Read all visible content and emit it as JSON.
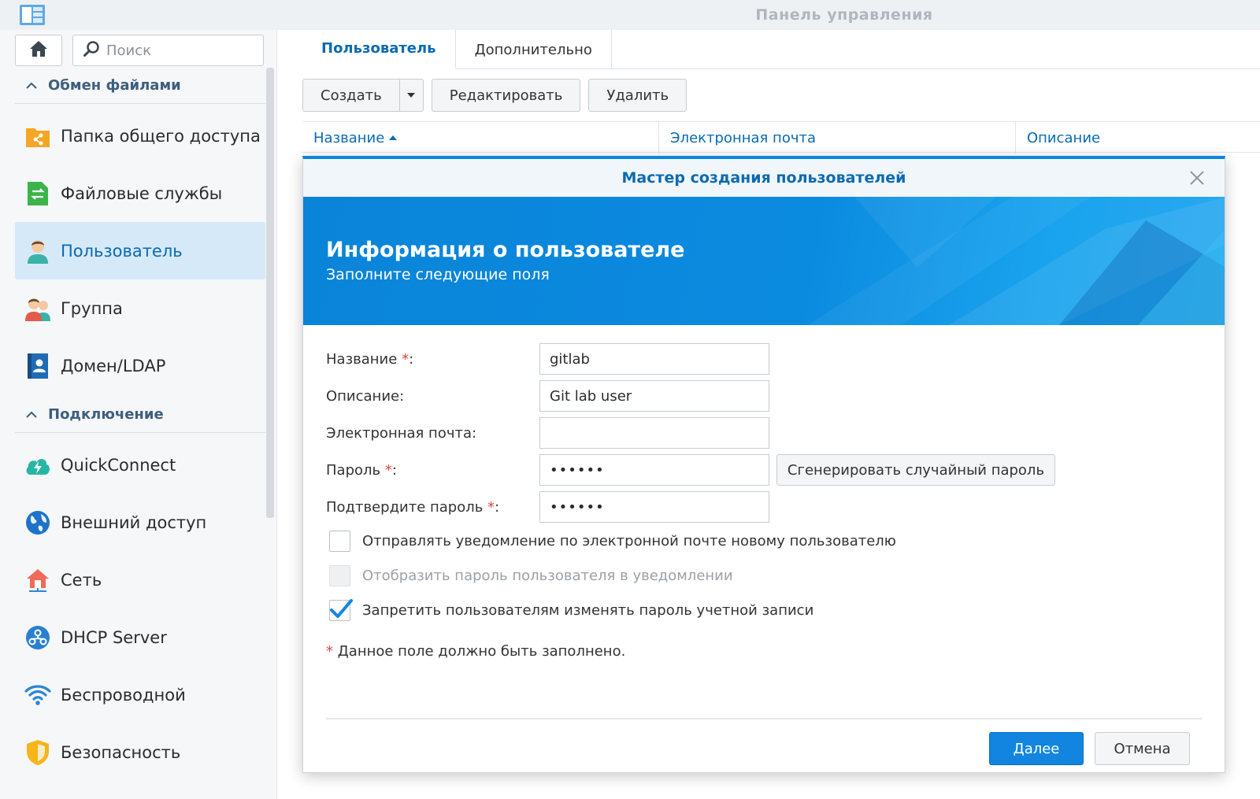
{
  "window": {
    "title": "Панель управления",
    "app_icon": "control-panel-icon"
  },
  "sidebar": {
    "home_icon": "home-icon",
    "search": {
      "placeholder": "Поиск",
      "value": ""
    },
    "sections": [
      {
        "label": "Обмен файлами",
        "items": [
          {
            "label": "Папка общего доступа",
            "icon": "shared-folder-icon"
          },
          {
            "label": "Файловые службы",
            "icon": "file-services-icon"
          },
          {
            "label": "Пользователь",
            "icon": "user-icon",
            "active": true
          },
          {
            "label": "Группа",
            "icon": "group-icon"
          },
          {
            "label": "Домен/LDAP",
            "icon": "domain-ldap-icon"
          }
        ]
      },
      {
        "label": "Подключение",
        "items": [
          {
            "label": "QuickConnect",
            "icon": "quickconnect-icon"
          },
          {
            "label": "Внешний доступ",
            "icon": "external-access-icon"
          },
          {
            "label": "Сеть",
            "icon": "network-icon"
          },
          {
            "label": "DHCP Server",
            "icon": "dhcp-server-icon"
          },
          {
            "label": "Беспроводной",
            "icon": "wireless-icon"
          },
          {
            "label": "Безопасность",
            "icon": "security-icon"
          }
        ]
      }
    ]
  },
  "main": {
    "tabs": [
      {
        "label": "Пользователь",
        "active": true
      },
      {
        "label": "Дополнительно",
        "active": false
      }
    ],
    "toolbar": {
      "create": "Создать",
      "edit": "Редактировать",
      "delete": "Удалить"
    },
    "columns": [
      {
        "label": "Название",
        "sort": "asc"
      },
      {
        "label": "Электронная почта"
      },
      {
        "label": "Описание"
      }
    ]
  },
  "dialog": {
    "title": "Мастер создания пользователей",
    "banner": {
      "title": "Информация о пользователе",
      "subtitle": "Заполните следующие поля"
    },
    "fields": {
      "name": {
        "label": "Название",
        "required": true,
        "value": "gitlab"
      },
      "description": {
        "label": "Описание:",
        "value": "Git lab user"
      },
      "email": {
        "label": "Электронная почта:",
        "value": ""
      },
      "password": {
        "label": "Пароль",
        "required": true,
        "value": "••••••"
      },
      "confirm": {
        "label": "Подтвердите пароль",
        "required": true,
        "value": "••••••"
      }
    },
    "generate_button": "Сгенерировать случайный пароль",
    "checkboxes": [
      {
        "label": "Отправлять уведомление по электронной почте новому пользователю",
        "checked": false,
        "disabled": false
      },
      {
        "label": "Отобразить пароль пользователя в уведомлении",
        "checked": false,
        "disabled": true
      },
      {
        "label": "Запретить пользователям изменять пароль учетной записи",
        "checked": true,
        "disabled": false
      }
    ],
    "required_note": "Данное поле должно быть заполнено.",
    "required_mark": "*",
    "buttons": {
      "next": "Далее",
      "cancel": "Отмена"
    }
  },
  "colors": {
    "accent": "#0a86d9",
    "link": "#0a6ab1",
    "required": "#e0453a",
    "active_bg": "#d6e9f8"
  }
}
